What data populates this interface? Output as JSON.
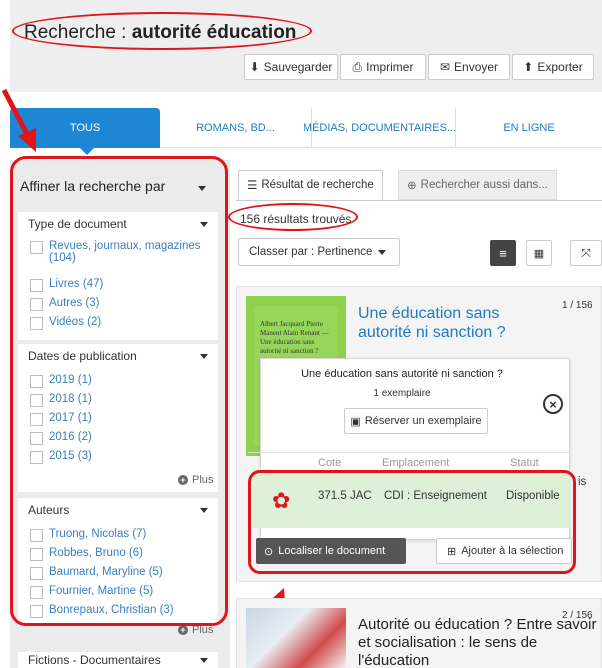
{
  "search": {
    "prefix": "Recherche : ",
    "query": "autorité éducation"
  },
  "toolbar": {
    "save": "Sauvegarder",
    "print": "Imprimer",
    "send": "Envoyer",
    "export": "Exporter"
  },
  "tabs": [
    {
      "label": "TOUS"
    },
    {
      "label": "ROMANS, BD..."
    },
    {
      "label": "MÉDIAS, DOCUMENTAIRES..."
    },
    {
      "label": "EN LIGNE"
    }
  ],
  "sidebar": {
    "title": "Affiner la recherche par",
    "more_label": "Plus",
    "facets": [
      {
        "title": "Type de document",
        "items": [
          "Revues, journaux, magazines (104)",
          "Livres (47)",
          "Autres (3)",
          "Vidéos (2)"
        ]
      },
      {
        "title": "Dates de publication",
        "items": [
          "2019 (1)",
          "2018 (1)",
          "2017 (1)",
          "2016 (2)",
          "2015 (3)"
        ]
      },
      {
        "title": "Auteurs",
        "items": [
          "Truong, Nicolas (7)",
          "Robbes, Bruno (6)",
          "Baumard, Maryline (5)",
          "Fournier, Martine (5)",
          "Bonrepaux, Christian (3)"
        ]
      },
      {
        "title": "Fictions - Documentaires"
      }
    ]
  },
  "results": {
    "tab_results": "Résultat de recherche",
    "tab_also": "Rechercher aussi dans...",
    "count": "156 résultats trouvés",
    "sort_label": "Classer par : Pertinence",
    "items": [
      {
        "title": "Une éducation sans autorité ni sanction ?",
        "index": "1 / 156",
        "cover_text": "Albert Jacquard  Pierre Manent  Alain Renaut — Une éducation sans autorité ni sanction ?"
      },
      {
        "title": "Autorité ou éducation ? Entre savoir et socialisation : le sens de l'éducation",
        "index": "2 / 156"
      }
    ]
  },
  "popup": {
    "title": "Une éducation sans autorité ni sanction ?",
    "copies": "1 exemplaire",
    "reserve": "Réserver un exemplaire",
    "headers": [
      "Cote",
      "Emplacement",
      "Statut"
    ],
    "row": {
      "cote": "371.5 JAC",
      "location": "CDI : Enseignement",
      "status": "Disponible"
    },
    "side_text": "is"
  },
  "actions": {
    "locate": "Localiser le document",
    "add": "Ajouter à la sélection"
  },
  "colors": {
    "accent": "#1d87d6",
    "annotation": "#e0141b",
    "available_bg": "#dff0d8"
  }
}
